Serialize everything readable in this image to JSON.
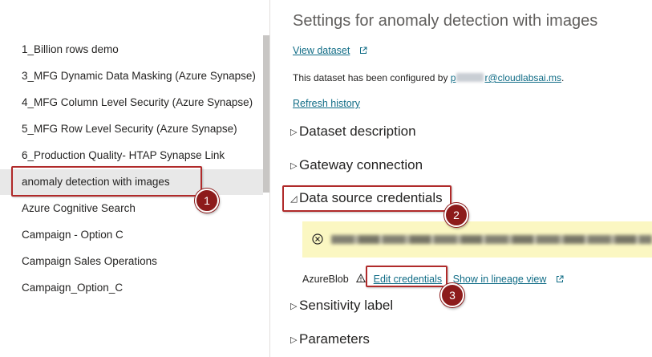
{
  "dataset_list": {
    "items": [
      {
        "label": "1_Billion rows demo",
        "selected": false
      },
      {
        "label": "3_MFG Dynamic Data Masking (Azure Synapse)",
        "selected": false
      },
      {
        "label": "4_MFG Column Level Security (Azure Synapse)",
        "selected": false
      },
      {
        "label": "5_MFG Row Level Security (Azure Synapse)",
        "selected": false
      },
      {
        "label": "6_Production Quality- HTAP Synapse Link",
        "selected": false
      },
      {
        "label": "anomaly detection with images",
        "selected": true
      },
      {
        "label": "Azure Cognitive Search",
        "selected": false
      },
      {
        "label": "Campaign - Option C",
        "selected": false
      },
      {
        "label": "Campaign Sales Operations",
        "selected": false
      },
      {
        "label": "Campaign_Option_C",
        "selected": false
      }
    ]
  },
  "settings": {
    "title": "Settings for anomaly detection with images",
    "view_dataset_link": "View dataset",
    "configured_by_prefix": "This dataset has been configured by ",
    "configured_by_email_start": "p",
    "configured_by_email_end": "r@cloudlabsai.ms",
    "configured_by_suffix": ".",
    "refresh_history_link": "Refresh history",
    "sections": {
      "dataset_description": "Dataset description",
      "gateway_connection": "Gateway connection",
      "data_source_credentials": "Data source credentials",
      "sensitivity_label": "Sensitivity label",
      "parameters": "Parameters"
    },
    "data_source": {
      "name": "AzureBlob",
      "edit_credentials_link": "Edit credentials",
      "lineage_link": "Show in lineage view"
    }
  },
  "annotations": {
    "step1": "1",
    "step2": "2",
    "step3": "3"
  },
  "colors": {
    "link": "#106c86",
    "callout": "#b02a2a",
    "badge": "#8d1b1b",
    "warning_banner": "#fbf7c2",
    "selected_row": "#e8e8e8"
  },
  "icons": {
    "external_link": "external-link-icon",
    "error": "error-circle-icon",
    "warning": "warning-triangle-icon"
  }
}
